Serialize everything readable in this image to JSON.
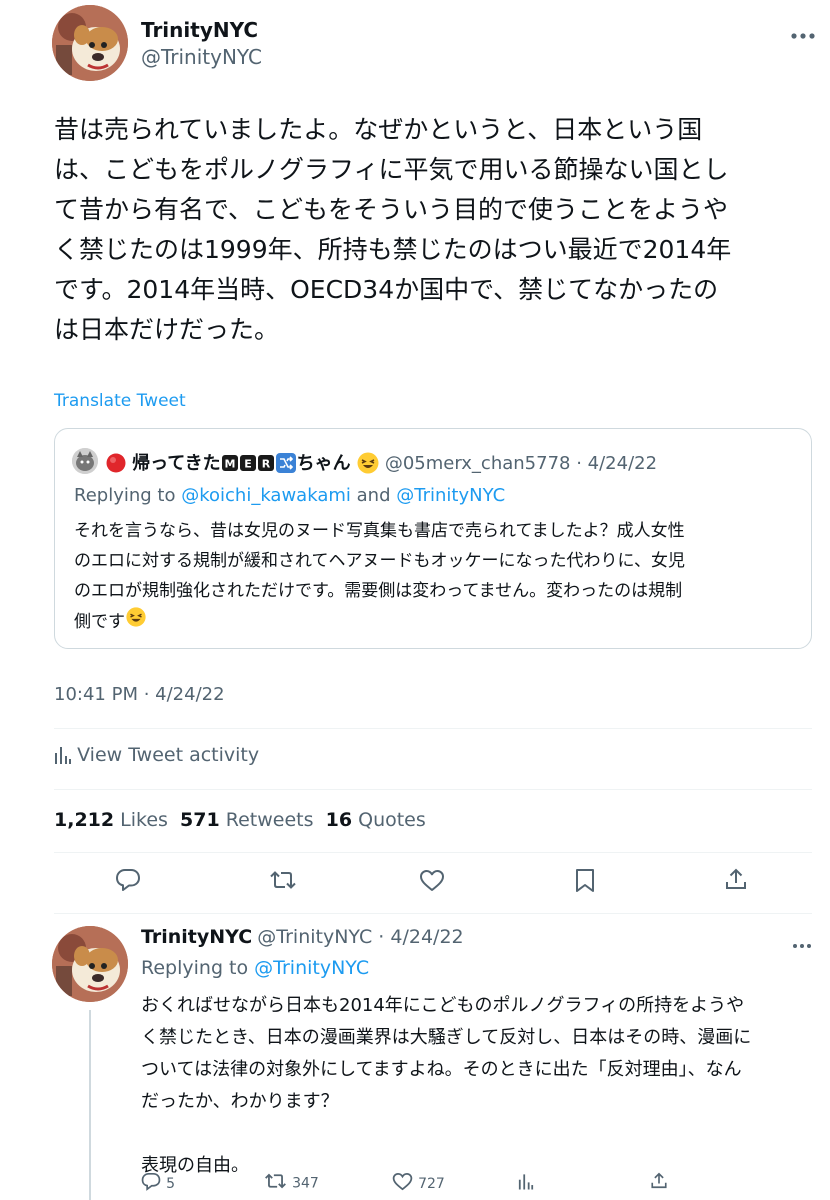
{
  "main_tweet": {
    "display_name": "TrinityNYC",
    "handle": "@TrinityNYC",
    "body_lines": [
      "昔は売られていましたよ。なぜかというと、日本という国",
      "は、こどもをポルノグラフィに平気で用いる節操ない国とし",
      "て昔から有名で、こどもをそういう目的で使うことをようや",
      "く禁じたのは1999年、所持も禁じたのはつい最近で2014年",
      "です。2014年当時、OECD34か国中で、禁じてなかったの",
      "は日本だけだった。"
    ],
    "translate_label": "Translate Tweet",
    "timestamp": "10:41 PM · 4/24/22",
    "activity_label": "View Tweet activity",
    "stats": {
      "likes_count": "1,212",
      "likes_label": "Likes",
      "retweets_count": "571",
      "retweets_label": "Retweets",
      "quotes_count": "16",
      "quotes_label": "Quotes"
    }
  },
  "quoted_tweet": {
    "display_name": "帰ってきたMER🔀ちゃん",
    "name_prefix": "帰ってきた",
    "name_badges": [
      "M",
      "E",
      "R"
    ],
    "name_suffix": "ちゃん",
    "handle_date": "@05merx_chan5778 · 4/24/22",
    "replying_prefix": "Replying to",
    "replying_mention_1": "@koichi_kawakami",
    "replying_and": "and",
    "replying_mention_2": "@TrinityNYC",
    "body_lines": [
      "それを言うなら、昔は女児のヌード写真集も書店で売られてましたよ？成人女性",
      "のエロに対する規制が緩和されてヘアヌードもオッケーになった代わりに、女児",
      "のエロが規制強化されただけです。需要側は変わってません。変わったのは規制",
      "側です"
    ]
  },
  "reply_tweet": {
    "display_name": "TrinityNYC",
    "handle_date": "@TrinityNYC · 4/24/22",
    "replying_prefix": "Replying to",
    "replying_mention": "@TrinityNYC",
    "body_lines": [
      "おくればせながら日本も2014年にこどものポルノグラフィの所持をようや",
      "く禁じたとき、日本の漫画業界は大騒ぎして反対し、日本はその時、漫画に",
      "ついては法律の対象外にしてますよね。そのときに出た「反対理由」、なん",
      "だったか、わかります？",
      "",
      "表現の自由。"
    ],
    "reply_count": "5",
    "retweet_count": "347",
    "like_count": "727"
  },
  "icons": {
    "reply": "reply-icon",
    "retweet": "retweet-icon",
    "like": "heart-icon",
    "bookmark": "bookmark-icon",
    "share": "share-icon",
    "more": "more-dots-icon",
    "activity": "bar-chart-icon"
  },
  "colors": {
    "accent": "#1d9bf0",
    "text": "#0f1419",
    "secondary": "#536471",
    "border": "#cfd9de"
  }
}
